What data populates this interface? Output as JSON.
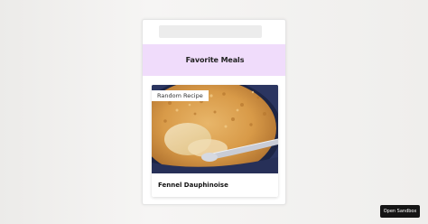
{
  "app": {
    "header_title": "Favorite Meals"
  },
  "card": {
    "badge": "Random Recipe",
    "recipe_name": "Fennel Dauphinoise",
    "image_subject": "baked gratin in a dark blue dish"
  },
  "sandbox": {
    "button_label": "Open Sandbox"
  },
  "colors": {
    "header_bg": "#f0dcfb",
    "search_bg": "#ececec",
    "sandbox_bg": "#151515"
  }
}
